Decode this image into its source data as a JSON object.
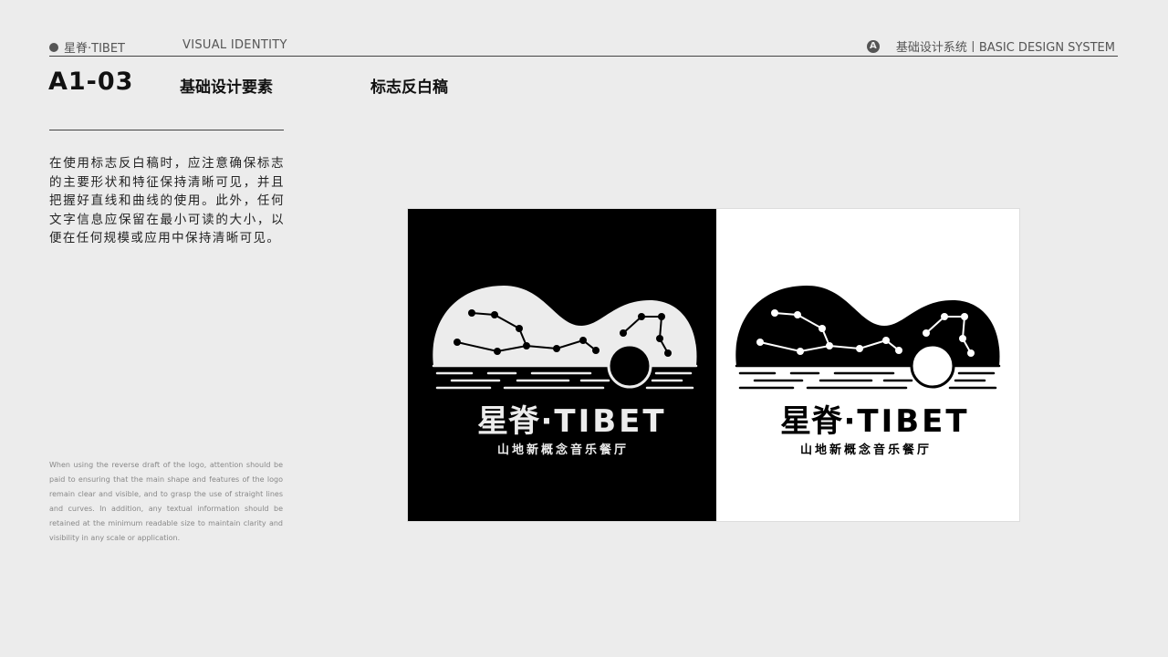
{
  "header": {
    "brand": "星脊·TIBET",
    "section": "VISUAL IDENTITY",
    "system_badge": "A",
    "system": "基础设计系统丨BASIC DESIGN SYSTEM"
  },
  "page": {
    "code": "A1-03",
    "category": "基础设计要素",
    "title": "标志反白稿"
  },
  "description": {
    "cn": "在使用标志反白稿时，应注意确保标志的主要形状和特征保持清晰可见，并且把握好直线和曲线的使用。此外，任何文字信息应保留在最小可读的大小，以便在任何规模或应用中保持清晰可见。",
    "en": "When using the reverse draft of the logo, attention should be paid to ensuring that the main shape and features of the logo remain clear and visible, and to grasp the use of straight lines and curves. In addition, any textual information should be retained at the minimum readable size to maintain clarity and visibility in any scale or application."
  },
  "logo": {
    "name_cn": "星脊",
    "dot": "·",
    "name_en": "TIBET",
    "tagline": "山地新概念音乐餐厅"
  },
  "colors": {
    "background": "#ececec",
    "dark_panel": "#000000",
    "light_panel": "#ffffff"
  }
}
